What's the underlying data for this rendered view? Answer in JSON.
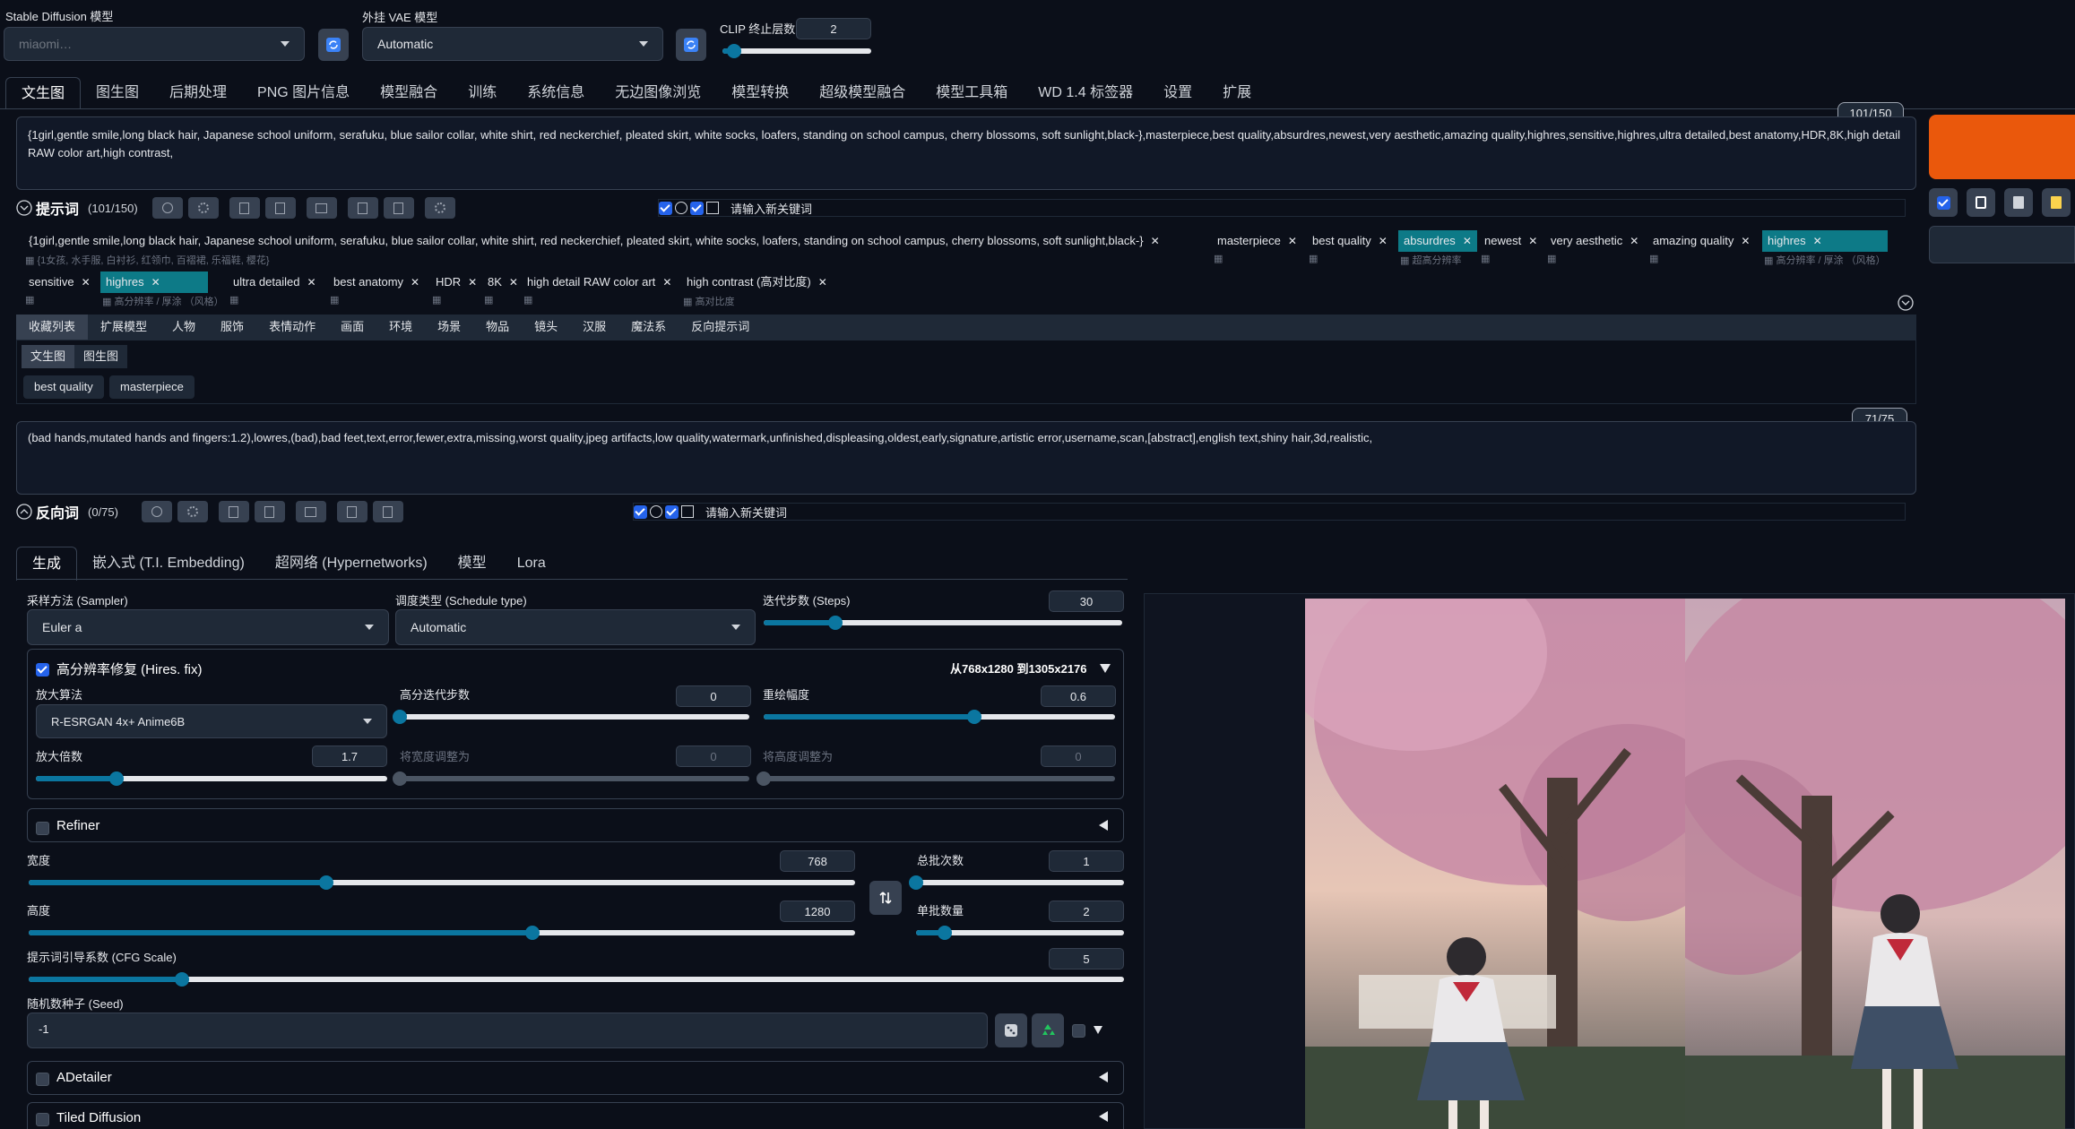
{
  "top": {
    "sd_model_label": "Stable Diffusion 模型",
    "sd_model_value": "miaomi…",
    "vae_label": "外挂 VAE 模型",
    "vae_value": "Automatic",
    "clip_label": "CLIP 终止层数",
    "clip_value": "2",
    "clip_fraction": 0.08
  },
  "main_tabs": [
    "文生图",
    "图生图",
    "后期处理",
    "PNG 图片信息",
    "模型融合",
    "训练",
    "系统信息",
    "无边图像浏览",
    "模型转换",
    "超级模型融合",
    "模型工具箱",
    "WD 1.4 标签器",
    "设置",
    "扩展"
  ],
  "prompt": {
    "counter": "101/150",
    "text": "{1girl,gentle smile,long black hair, Japanese school uniform, serafuku, blue sailor collar, white shirt, red neckerchief, pleated skirt, white socks, loafers, standing on school campus, cherry blossoms, soft sunlight,black-},masterpiece,best quality,absurdres,newest,very aesthetic,amazing quality,highres,sensitive,highres,ultra detailed,best anatomy,HDR,8K,high detail RAW color art,high contrast,",
    "label": "提示词",
    "count": "(101/150)",
    "keyword_placeholder": "请输入新关键词"
  },
  "tags_row1": [
    {
      "text": "{1girl,gentle smile,long black hair, Japanese school uniform, serafuku, blue sailor collar, white shirt, red neckerchief, pleated skirt, white socks, loafers, standing on school campus, cherry blossoms, soft sunlight,black-}",
      "sub": "{1女孩, 水手服, 白衬衫, 红领巾, 百褶裙, 乐福鞋, 樱花}"
    },
    {
      "text": "masterpiece",
      "sub": ""
    },
    {
      "text": "best quality",
      "sub": ""
    },
    {
      "text": "absurdres",
      "sub": "超高分辨率"
    },
    {
      "text": "newest",
      "sub": ""
    },
    {
      "text": "very aesthetic",
      "sub": ""
    },
    {
      "text": "amazing quality",
      "sub": ""
    },
    {
      "text": "highres",
      "sub": "高分辨率 / 厚涂 （风格）"
    }
  ],
  "tags_row2": [
    {
      "text": "sensitive",
      "sub": ""
    },
    {
      "text": "highres",
      "sub": "高分辨率 / 厚涂 （风格）"
    },
    {
      "text": "ultra detailed",
      "sub": ""
    },
    {
      "text": "best anatomy",
      "sub": ""
    },
    {
      "text": "HDR",
      "sub": ""
    },
    {
      "text": "8K",
      "sub": ""
    },
    {
      "text": "high detail RAW color art",
      "sub": ""
    },
    {
      "text": "high contrast (高对比度)",
      "sub": "高对比度"
    }
  ],
  "fav_tabs": [
    "收藏列表",
    "扩展模型",
    "人物",
    "服饰",
    "表情动作",
    "画面",
    "环境",
    "场景",
    "物品",
    "镜头",
    "汉服",
    "魔法系",
    "反向提示词"
  ],
  "fav_subtabs": [
    "文生图",
    "图生图"
  ],
  "fav_chips": [
    "best quality",
    "masterpiece"
  ],
  "negative": {
    "counter": "71/75",
    "text": "(bad hands,mutated hands and fingers:1.2),lowres,(bad),bad feet,text,error,fewer,extra,missing,worst quality,jpeg artifacts,low quality,watermark,unfinished,displeasing,oldest,early,signature,artistic error,username,scan,[abstract],english text,shiny hair,3d,realistic,",
    "label": "反向词",
    "count": "(0/75)",
    "keyword_placeholder": "请输入新关键词"
  },
  "gen_tabs": [
    "生成",
    "嵌入式 (T.I. Embedding)",
    "超网络 (Hypernetworks)",
    "模型",
    "Lora"
  ],
  "sampler": {
    "label": "采样方法 (Sampler)",
    "value": "Euler a"
  },
  "schedule": {
    "label": "调度类型 (Schedule type)",
    "value": "Automatic"
  },
  "steps": {
    "label": "迭代步数 (Steps)",
    "value": "30",
    "fraction": 0.2
  },
  "hires": {
    "label": "高分辨率修复 (Hires. fix)",
    "info": "从768x1280 到1305x2176",
    "upscaler_label": "放大算法",
    "upscaler_value": "R-ESRGAN 4x+ Anime6B",
    "hires_steps_label": "高分迭代步数",
    "hires_steps_value": "0",
    "hires_steps_fraction": 0.0,
    "denoise_label": "重绘幅度",
    "denoise_value": "0.6",
    "denoise_fraction": 0.6,
    "scale_label": "放大倍数",
    "scale_value": "1.7",
    "scale_fraction": 0.23,
    "resize_w_label": "将宽度调整为",
    "resize_w_value": "0",
    "resize_h_label": "将高度调整为",
    "resize_h_value": "0"
  },
  "refiner": {
    "label": "Refiner"
  },
  "width": {
    "label": "宽度",
    "value": "768",
    "fraction": 0.36
  },
  "height": {
    "label": "高度",
    "value": "1280",
    "fraction": 0.61
  },
  "batch_count": {
    "label": "总批次数",
    "value": "1",
    "fraction": 0.0
  },
  "batch_size": {
    "label": "单批数量",
    "value": "2",
    "fraction": 0.14
  },
  "cfg": {
    "label": "提示词引导系数 (CFG Scale)",
    "value": "5",
    "fraction": 0.14
  },
  "seed": {
    "label": "随机数种子 (Seed)",
    "value": "-1"
  },
  "adetailer": {
    "label": "ADetailer"
  },
  "tiled": {
    "label": "Tiled Diffusion"
  },
  "colors": {
    "accent": "#0b76a0",
    "generate": "#ea580c",
    "tag_highlight": "#0d7a87"
  }
}
